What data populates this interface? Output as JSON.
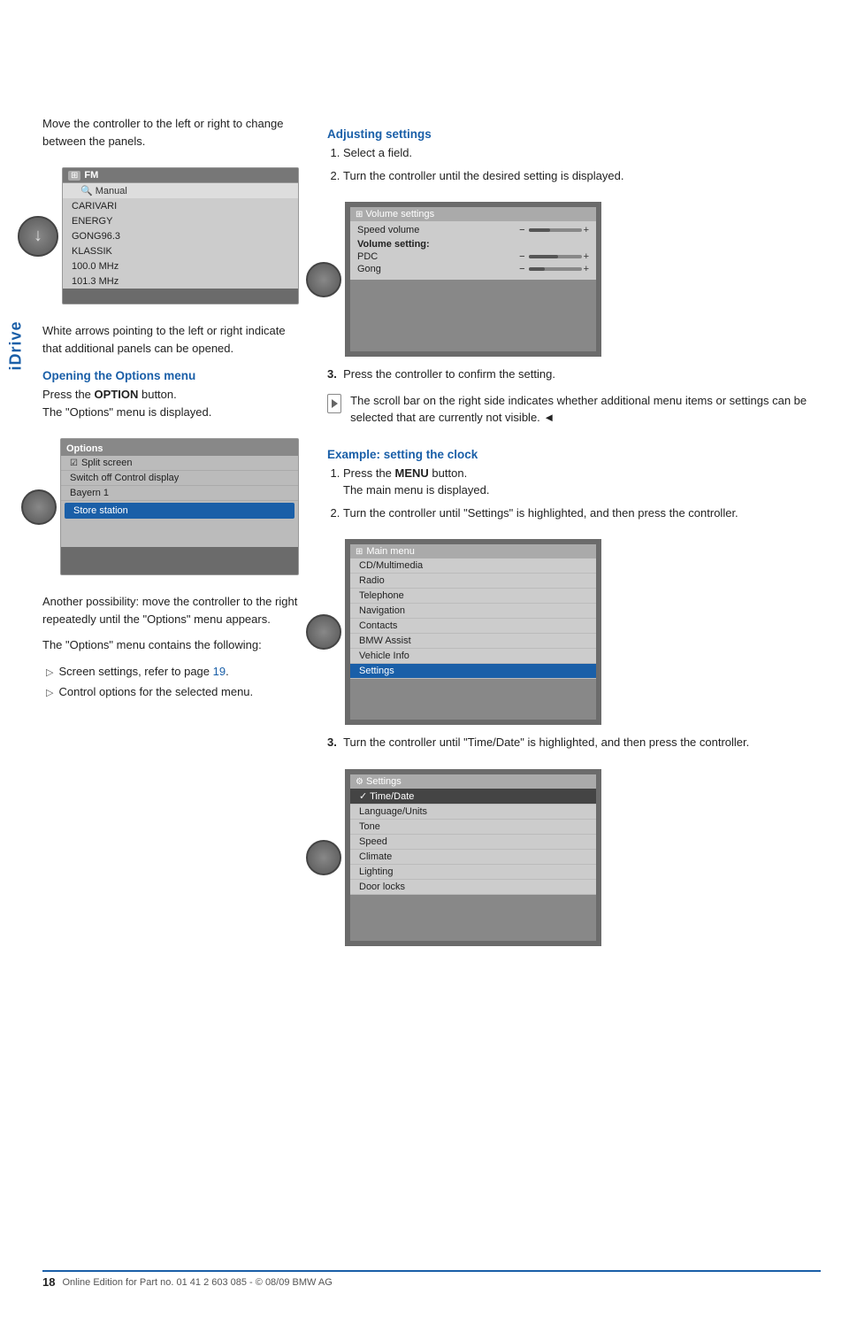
{
  "sidebar": {
    "label": "iDrive"
  },
  "left_col": {
    "intro_para": "Move the controller to the left or right to change between the panels.",
    "fm_screen": {
      "title": "FM",
      "menu_items": [
        "Manual",
        "CARIVARI",
        "ENERGY",
        "GONG96.3",
        "KLASSIK",
        "100.0 MHz",
        "101.3 MHz"
      ]
    },
    "white_arrows_para": "White arrows pointing to the left or right indicate that additional panels can be opened.",
    "opening_heading": "Opening the Options menu",
    "opening_step1": "Press the OPTION button.",
    "opening_step1_bold": "OPTION",
    "opening_step2": "The \"Options\" menu is displayed.",
    "options_screen": {
      "title": "Options",
      "items": [
        "Split screen",
        "Switch off Control display",
        "Bayern 1",
        "Store station"
      ]
    },
    "another_para": "Another possibility: move the controller to the right repeatedly until the \"Options\" menu appears.",
    "contains_para": "The \"Options\" menu contains the following:",
    "bullet_items": [
      "Screen settings, refer to page 19.",
      "Control options for the selected menu."
    ],
    "page_ref": "19"
  },
  "right_col": {
    "adjusting_heading": "Adjusting settings",
    "adj_steps": [
      "Select a field.",
      "Turn the controller until the desired setting is displayed."
    ],
    "volume_screen": {
      "title": "Volume settings",
      "speed_volume_label": "Speed volume",
      "volume_setting_label": "Volume setting:",
      "pdc_label": "PDC",
      "gong_label": "Gong"
    },
    "adj_step3": "Press the controller to confirm the setting.",
    "scroll_note": "The scroll bar on the right side indicates whether additional menu items or settings can be selected that are currently not visible.",
    "end_mark": "◄",
    "example_heading": "Example: setting the clock",
    "example_steps": [
      {
        "num": "1.",
        "text": "Press the MENU button.",
        "bold": "MENU",
        "sub": "The main menu is displayed."
      },
      {
        "num": "2.",
        "text": "Turn the controller until \"Settings\" is highlighted, and then press the controller."
      }
    ],
    "main_menu_screen": {
      "title": "Main menu",
      "items": [
        "CD/Multimedia",
        "Radio",
        "Telephone",
        "Navigation",
        "Contacts",
        "BMW Assist",
        "Vehicle Info",
        "Settings"
      ]
    },
    "example_step3": "Turn the controller until \"Time/Date\" is highlighted, and then press the controller.",
    "settings_screen": {
      "title": "Settings",
      "items": [
        "Time/Date",
        "Language/Units",
        "Tone",
        "Speed",
        "Climate",
        "Lighting",
        "Door locks"
      ]
    }
  },
  "footer": {
    "page_num": "18",
    "footer_text": "Online Edition for Part no. 01 41 2 603 085 - © 08/09 BMW AG"
  }
}
